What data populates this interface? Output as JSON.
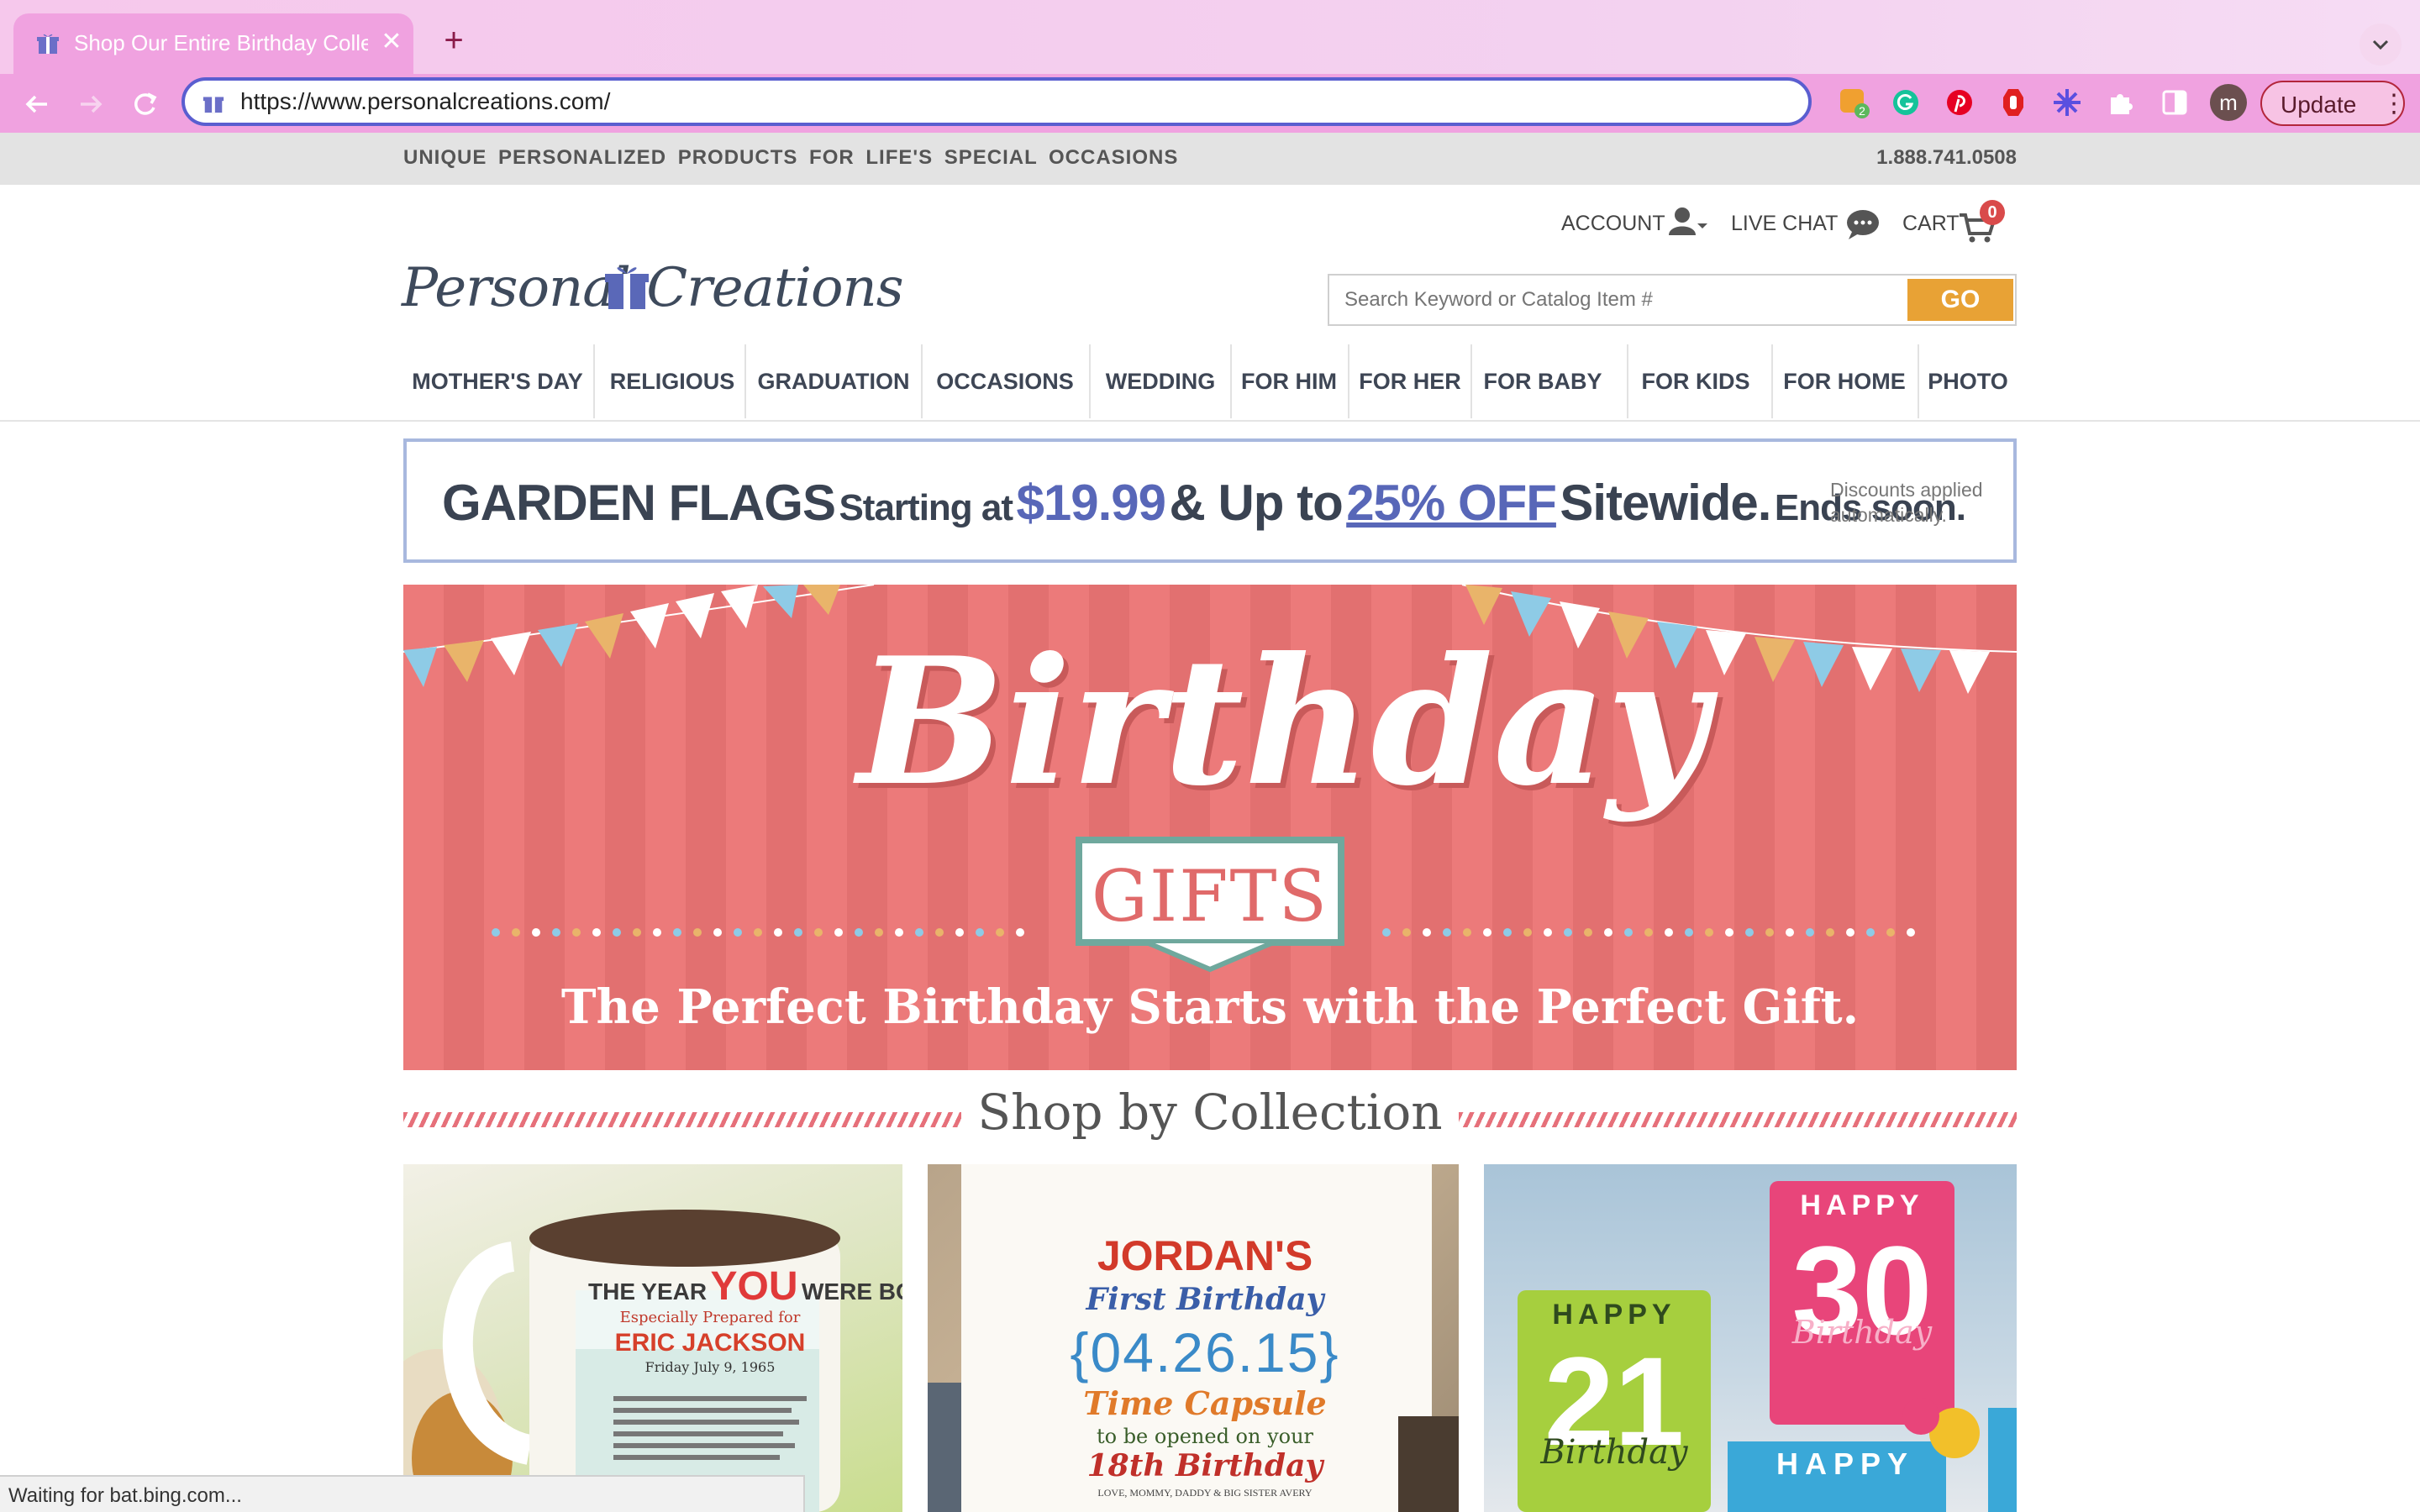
{
  "browser": {
    "tab_title": "Shop Our Entire Birthday Collection",
    "new_tab_symbol": "+",
    "close_symbol": "✕",
    "url": "https://www.personalcreations.com/",
    "profile_initial": "m",
    "update_label": "Update",
    "extension_badge": "2",
    "status": "Waiting for bat.bing.com..."
  },
  "promo": {
    "tagline": "UNIQUE PERSONALIZED PRODUCTS FOR LIFE'S SPECIAL OCCASIONS",
    "phone": "1.888.741.0508"
  },
  "header": {
    "logo_text": "Personal Creations",
    "account_label": "ACCOUNT",
    "chat_label": "LIVE CHAT",
    "cart_label": "CART",
    "cart_count": "0",
    "search_placeholder": "Search Keyword or Catalog Item #",
    "search_button": "GO"
  },
  "nav": [
    {
      "label": "MOTHER'S DAY"
    },
    {
      "label": "RELIGIOUS"
    },
    {
      "label": "GRADUATION"
    },
    {
      "label": "OCCASIONS"
    },
    {
      "label": "WEDDING"
    },
    {
      "label": "FOR HIM"
    },
    {
      "label": "FOR HER"
    },
    {
      "label": "FOR BABY"
    },
    {
      "label": "FOR KIDS"
    },
    {
      "label": "FOR HOME"
    },
    {
      "label": "PHOTO"
    }
  ],
  "sale_banner": {
    "part1": "GARDEN FLAGS",
    "part2": "Starting at",
    "part3": "$19.99",
    "part4": "& Up to",
    "part5": "25% OFF",
    "part6": "Sitewide.",
    "part7": "Ends soon.",
    "note": "Discounts applied automatically."
  },
  "hero": {
    "title": "Birthday",
    "badge": "GIFTS",
    "subtitle": "The Perfect Birthday Starts with the Perfect Gift."
  },
  "collections": {
    "title": "Shop by Collection",
    "cards": [
      {
        "line1": "THE YEAR",
        "line2": "YOU",
        "line3": "WERE BORN",
        "line4": "Especially Prepared for",
        "line5": "ERIC JACKSON",
        "line6": "Friday July 9, 1965"
      },
      {
        "line1": "JORDAN'S",
        "line2": "First Birthday",
        "line3": "{04.26.15}",
        "line4": "Time Capsule",
        "line5": "to be opened on your",
        "line6": "18th Birthday",
        "line7": "LOVE, MOMMY, DADDY & BIG SISTER AVERY"
      },
      {
        "line1": "HAPPY",
        "line2": "30",
        "line3": "Birthday",
        "line4": "HAPPY",
        "line5": "21",
        "line6": "Birthday",
        "line7": "HAPPY"
      }
    ]
  },
  "colors": {
    "tab_bg": "#f0a2e0",
    "accent_go": "#e8a235",
    "hero_red": "#ec7a7a",
    "sale_blue": "#5867b8",
    "nav_text": "#3e4655"
  }
}
